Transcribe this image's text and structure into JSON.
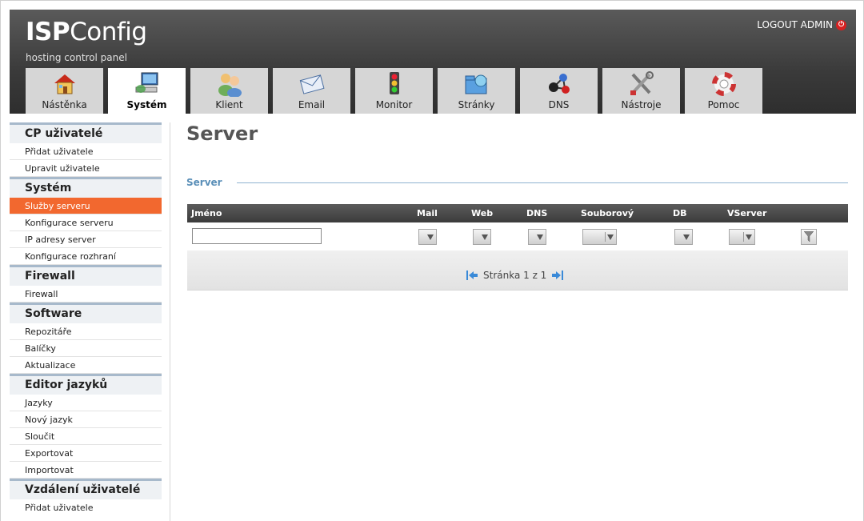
{
  "header": {
    "logo_bold": "ISP",
    "logo_rest": "Config",
    "tagline": "hosting control panel",
    "logout_label": "LOGOUT ADMIN"
  },
  "tabs": [
    {
      "label": "Nástěnka",
      "icon": "house-icon",
      "active": false
    },
    {
      "label": "Systém",
      "icon": "computer-icon",
      "active": true
    },
    {
      "label": "Klient",
      "icon": "users-icon",
      "active": false
    },
    {
      "label": "Email",
      "icon": "envelope-icon",
      "active": false
    },
    {
      "label": "Monitor",
      "icon": "traffic-light-icon",
      "active": false
    },
    {
      "label": "Stránky",
      "icon": "web-folder-icon",
      "active": false
    },
    {
      "label": "DNS",
      "icon": "network-molecule-icon",
      "active": false
    },
    {
      "label": "Nástroje",
      "icon": "tools-icon",
      "active": false
    },
    {
      "label": "Pomoc",
      "icon": "lifebuoy-icon",
      "active": false
    }
  ],
  "sidebar": {
    "sections": [
      {
        "title": "CP uživatelé",
        "items": [
          "Přidat uživatele",
          "Upravit uživatele"
        ]
      },
      {
        "title": "Systém",
        "items": [
          "Služby serveru",
          "Konfigurace serveru",
          "IP adresy server",
          "Konfigurace rozhraní"
        ]
      },
      {
        "title": "Firewall",
        "items": [
          "Firewall"
        ]
      },
      {
        "title": "Software",
        "items": [
          "Repozitáře",
          "Balíčky",
          "Aktualizace"
        ]
      },
      {
        "title": "Editor jazyků",
        "items": [
          "Jazyky",
          "Nový jazyk",
          "Sloučit",
          "Exportovat",
          "Importovat"
        ]
      },
      {
        "title": "Vzdálení uživatelé",
        "items": [
          "Přidat uživatele"
        ]
      }
    ],
    "active_item": "Služby serveru"
  },
  "main": {
    "page_title": "Server",
    "section_title": "Server",
    "columns": [
      "Jméno",
      "Mail",
      "Web",
      "DNS",
      "Souborový",
      "DB",
      "VServer"
    ],
    "name_filter_value": "",
    "pager_text": "Stránka 1 z 1"
  },
  "colors": {
    "header_dark": "#3a3a3a",
    "active_item": "#f2682f",
    "section_title": "#5a8fb8"
  }
}
